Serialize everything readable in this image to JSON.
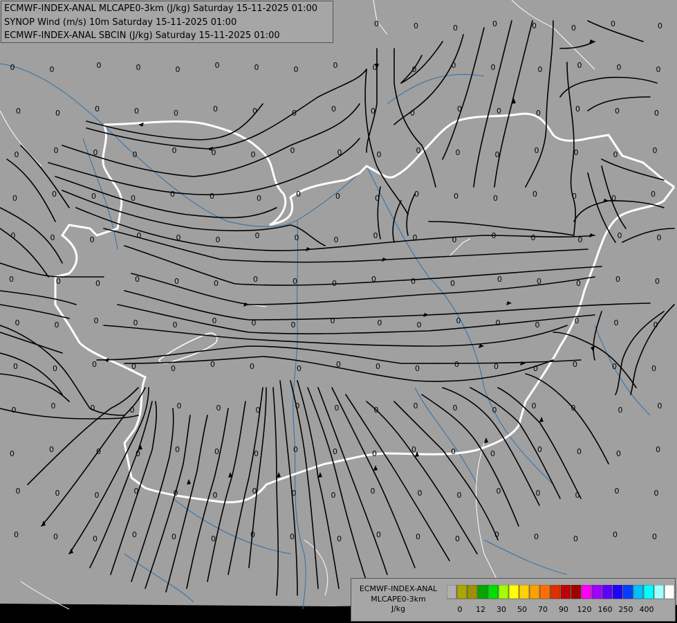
{
  "titles": [
    "ECMWF-INDEX-ANAL MLCAPE0-3km (J/kg) Saturday 15-11-2025 01:00",
    "SYNOP Wind (m/s) 10m Saturday 15-11-2025 01:00",
    "ECMWF-INDEX-ANAL SBCIN (J/kg) Saturday 15-11-2025 01:00"
  ],
  "legend": {
    "product": "ECMWF-INDEX-ANAL",
    "field": "MLCAPE0-3km",
    "unit": "J/kg",
    "colors": [
      "#b0b0b0",
      "#a8a800",
      "#a09000",
      "#00a800",
      "#00e000",
      "#a0ff00",
      "#ffff00",
      "#ffd000",
      "#ffa000",
      "#ff7000",
      "#e03000",
      "#c00000",
      "#a00000",
      "#ff00ff",
      "#a000ff",
      "#6000ff",
      "#2000ff",
      "#0040ff",
      "#00c0ff",
      "#00ffff",
      "#a0ffff",
      "#ffffff"
    ],
    "tick_labels": [
      "0",
      "12",
      "30",
      "50",
      "70",
      "90",
      "120",
      "160",
      "250",
      "400"
    ]
  },
  "sbcin_value_label": "0"
}
